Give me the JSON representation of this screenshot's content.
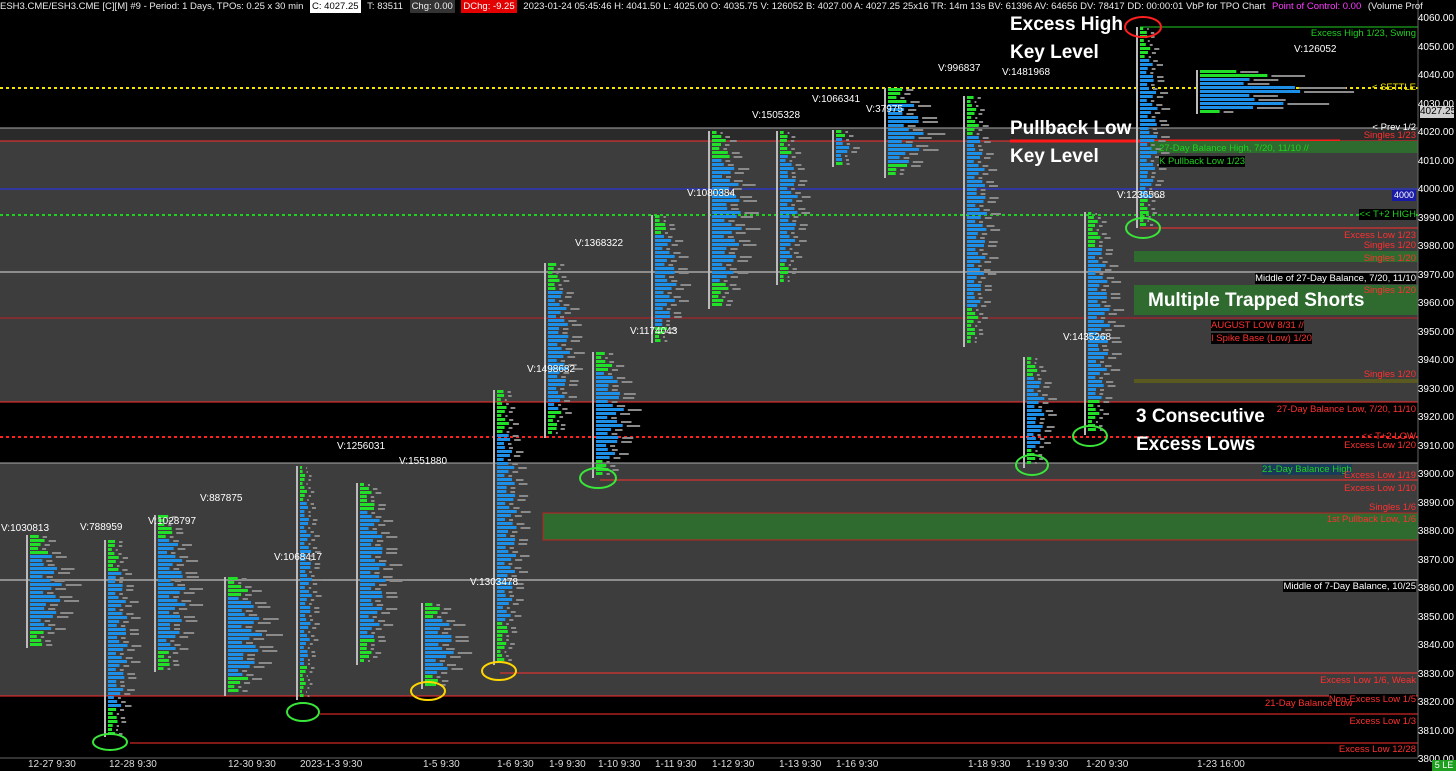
{
  "header": {
    "symbol": "ESH3.CME/ESH3.CME [C][M]  #9 - Period: 1 Days, TPOs: 0.25 x 30 min",
    "close": "C: 4027.25",
    "trades": "T: 83511",
    "change": "Chg: 0.00",
    "dchange": "DChg: -9.25",
    "details": "2023-01-24 05:45:46 H: 4041.50 L: 4025.00 O: 4035.75 V: 126052 B: 4027.00 A: 4027.25 25x16 TR: 14m 13s BV: 61396 AV: 64656 DV: 78417 DD: 00:00:01 VbP for TPO Chart",
    "poc": "Point of Control: 0.00",
    "tail": "(Volume Prof"
  },
  "price_axis": [
    "4060.00",
    "4050.00",
    "4040.00",
    "4030.00",
    "4020.00",
    "4010.00",
    "4000.00",
    "3990.00",
    "3980.00",
    "3970.00",
    "3960.00",
    "3950.00",
    "3940.00",
    "3930.00",
    "3920.00",
    "3910.00",
    "3900.00",
    "3890.00",
    "3880.00",
    "3870.00",
    "3860.00",
    "3850.00",
    "3840.00",
    "3830.00",
    "3820.00",
    "3810.00",
    "3800.00"
  ],
  "current_price": "4027.25",
  "blue_level_price": "4000",
  "time_axis": [
    "12-27  9:30",
    "12-28  9:30",
    "12-30  9:30",
    "2023-1-3  9:30",
    "1-5  9:30",
    "1-6  9:30",
    "1-9  9:30",
    "1-10  9:30",
    "1-11  9:30",
    "1-12  9:30",
    "1-13  9:30",
    "1-16  9:30",
    "1-18  9:30",
    "1-19  9:30",
    "1-20  9:30",
    "1-23  16:00"
  ],
  "volumes": [
    "V:1030813",
    "V:788959",
    "V:1028797",
    "V:887875",
    "V:1068417",
    "V:1256031",
    "V:1551880",
    "V:1303478",
    "V:1498682",
    "V:1368322",
    "V:1174043",
    "V:1080384",
    "V:1505328",
    "V:1066341",
    "V:37975",
    "V:996837",
    "V:1481968",
    "V:1435268",
    "V:1236568",
    "V:126052"
  ],
  "level_labels": {
    "excess_high": "Excess High 1/23, Swing",
    "settle": "< SETTLE",
    "prev": "< Prev 1/2",
    "singles_top": "Singles 1/23",
    "balance_high": "27-Day Balance High, 7/20, 11/10 //",
    "pullback_low": "K Pullback Low 1/23",
    "t2_high": "<< T+2 HIGH",
    "excess_low_123": "Excess Low 1/23",
    "singles_a": "Singles 1/20",
    "singles_b": "Singles 1/20",
    "middle_27": "Middle of 27-Day Balance, 7/20, 11/10",
    "singles_c": "Singles 1/20",
    "august_low": "AUGUST LOW 8/31 //",
    "spike_base": "I Spike Base (Low) 1/20",
    "singles_d": "Singles 1/20",
    "balance_low": "27-Day Balance Low, 7/20, 11/10",
    "t2_low": "<< T+2 LOW",
    "excess_low_120": "Excess Low 1/20",
    "balance_21": "21-Day Balance High",
    "excess_low_119": "Excess Low 1/19",
    "excess_low_110": "Excess Low 1/10",
    "singles_e": "Singles 1/6",
    "first_pullback": "1st Pullback Low, 1/6",
    "middle_7": "Middle of 7-Day Balance, 10/25",
    "excess_low_16": "Excess Low 1/6, Weak",
    "non_excess": "Non-Excess Low 1/5",
    "balance_21_low": "21-Day Balance Low",
    "excess_low_13": "Excess Low 1/3",
    "excess_low_1228": "Excess Low 12/28"
  },
  "annotations": {
    "excess_high": "Excess High",
    "key_level_1": "Key Level",
    "pullback_low": "Pullback Low",
    "key_level_2": "Key Level",
    "trapped_shorts": "Multiple Trapped Shorts",
    "consecutive": "3 Consecutive",
    "excess_lows": "Excess Lows"
  },
  "status_tag": "5 LE",
  "colors": {
    "tpo_blue": "#1e8fe6",
    "tpo_green": "#22e02a",
    "excess_green": "#2f6b2f",
    "settle_yellow": "#f5e600",
    "t2_green": "#1fd11f",
    "dotted_red": "#ff2020",
    "level_red": "#ff2a2a",
    "circle_green": "#39e639",
    "circle_yellow": "#ffd700"
  }
}
